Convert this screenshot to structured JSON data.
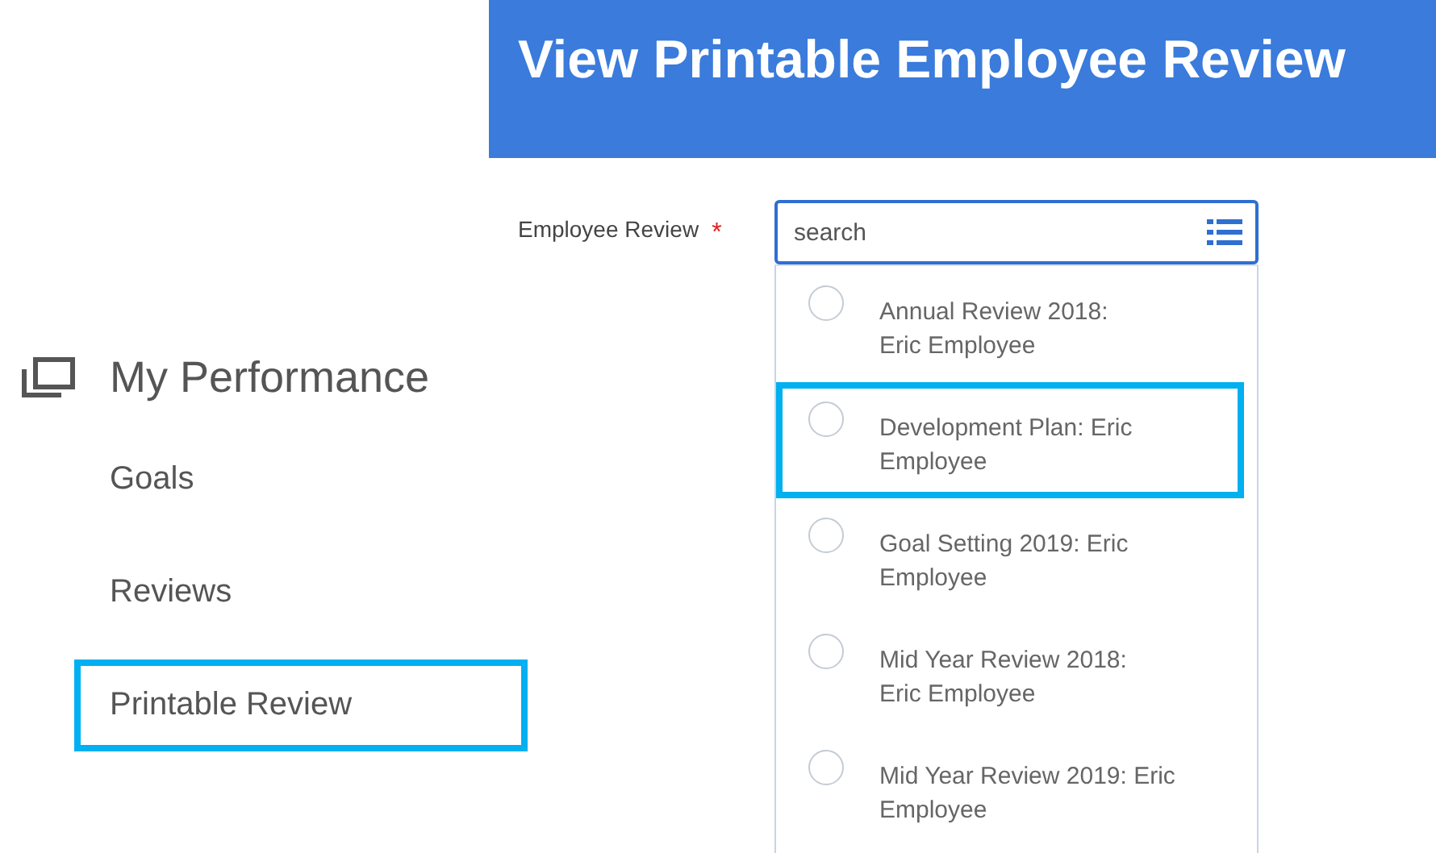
{
  "page_title": "View Printable Employee Review",
  "sidebar": {
    "title": "My Performance",
    "items": [
      {
        "label": "Goals",
        "highlighted": false
      },
      {
        "label": "Reviews",
        "highlighted": false
      },
      {
        "label": "Printable Review",
        "highlighted": true
      }
    ]
  },
  "field": {
    "label": "Employee Review",
    "required_mark": "*",
    "placeholder": "search"
  },
  "options": [
    {
      "label": "Annual Review 2018:\nEric Employee",
      "selected": false,
      "highlighted": false
    },
    {
      "label": "Development Plan: Eric\nEmployee",
      "selected": false,
      "highlighted": true
    },
    {
      "label": "Goal Setting 2019: Eric\nEmployee",
      "selected": false,
      "highlighted": false
    },
    {
      "label": "Mid Year Review 2018:\nEric Employee",
      "selected": false,
      "highlighted": false
    },
    {
      "label": "Mid Year Review 2019: Eric\nEmployee",
      "selected": false,
      "highlighted": false
    }
  ]
}
